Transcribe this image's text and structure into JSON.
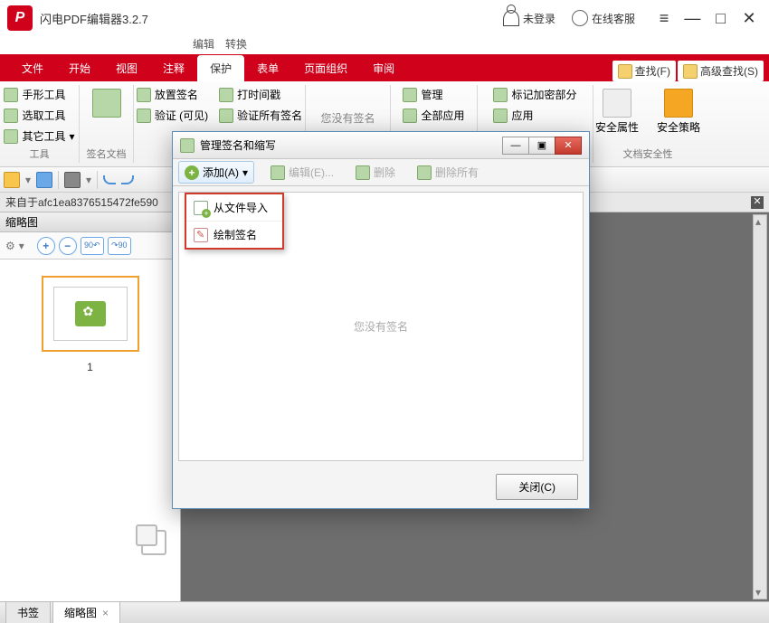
{
  "app": {
    "title": "闪电PDF编辑器3.2.7"
  },
  "titlebar": {
    "login": "未登录",
    "service": "在线客服"
  },
  "menubar": {
    "edit": "编辑",
    "convert": "转换"
  },
  "tabs": {
    "file": "文件",
    "start": "开始",
    "view": "视图",
    "comment": "注释",
    "protect": "保护",
    "form": "表单",
    "organize": "页面组织",
    "review": "审阅",
    "find": "查找(F)",
    "advfind": "高级查找(S)"
  },
  "ribbon": {
    "tools_group": "工具",
    "hand": "手形工具",
    "select": "选取工具",
    "other": "其它工具",
    "sigdoc_group": "签名文档",
    "sigdoc": "签名文档",
    "place": "放置签名",
    "verify": "验证 (可见)",
    "time": "打时间戳",
    "verify_all": "验证所有签名",
    "nosig": "您没有签名",
    "manage": "管理",
    "apply_all": "全部应用",
    "mark": "标记加密部分",
    "apply": "应用",
    "sec_group": "文档安全性",
    "sec_attr": "安全属性",
    "sec_pol": "安全策略"
  },
  "docbar": {
    "filename": "来自于afc1ea8376515472fe590"
  },
  "left": {
    "header": "缩略图",
    "page1": "1",
    "tab_bookmark": "书签",
    "tab_thumb": "缩略图"
  },
  "dialog": {
    "title": "管理签名和缩写",
    "add": "添加(A)",
    "edit": "编辑(E)...",
    "delete": "删除",
    "delete_all": "删除所有",
    "empty": "您没有签名",
    "dd_import": "从文件导入",
    "dd_draw": "绘制签名",
    "close": "关闭(C)"
  }
}
